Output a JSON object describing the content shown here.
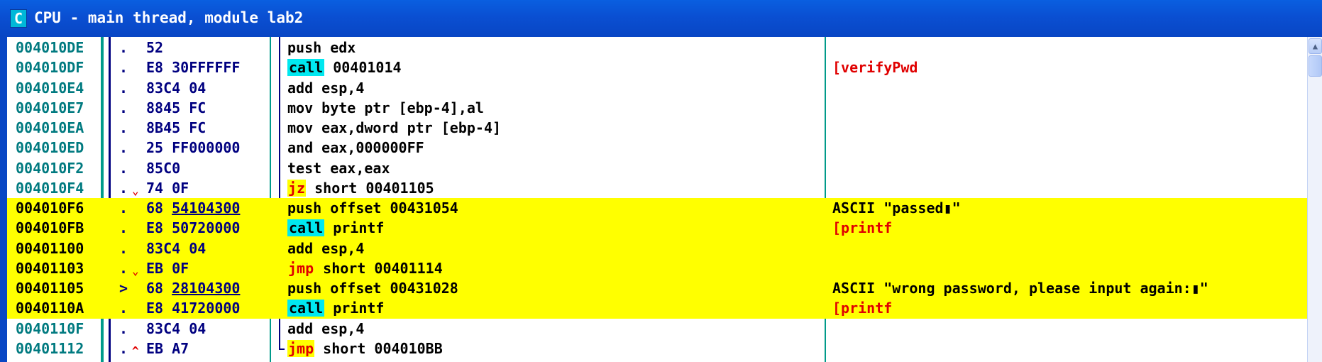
{
  "window": {
    "icon_letter": "C",
    "title": "CPU - main thread, module lab2"
  },
  "rows": [
    {
      "addr": "004010DE",
      "mark": ".",
      "jdir": "",
      "hex_pre": "52",
      "hex_ul": "",
      "mnem": "",
      "op": "push edx",
      "mnem_kind": "",
      "comment": "",
      "comment_kind": "",
      "hl": false
    },
    {
      "addr": "004010DF",
      "mark": ".",
      "jdir": "",
      "hex_pre": "E8 30FFFFFF",
      "hex_ul": "",
      "mnem": "call",
      "op": " 00401014",
      "mnem_kind": "call",
      "comment": "verifyPwd",
      "comment_kind": "fn",
      "hl": false
    },
    {
      "addr": "004010E4",
      "mark": ".",
      "jdir": "",
      "hex_pre": "83C4 04",
      "hex_ul": "",
      "mnem": "",
      "op": "add esp,4",
      "mnem_kind": "",
      "comment": "",
      "comment_kind": "",
      "hl": false
    },
    {
      "addr": "004010E7",
      "mark": ".",
      "jdir": "",
      "hex_pre": "8845 FC",
      "hex_ul": "",
      "mnem": "",
      "op": "mov byte ptr [ebp-4],al",
      "mnem_kind": "",
      "comment": "",
      "comment_kind": "",
      "hl": false
    },
    {
      "addr": "004010EA",
      "mark": ".",
      "jdir": "",
      "hex_pre": "8B45 FC",
      "hex_ul": "",
      "mnem": "",
      "op": "mov eax,dword ptr [ebp-4]",
      "mnem_kind": "",
      "comment": "",
      "comment_kind": "",
      "hl": false
    },
    {
      "addr": "004010ED",
      "mark": ".",
      "jdir": "",
      "hex_pre": "25 FF000000",
      "hex_ul": "",
      "mnem": "",
      "op": "and eax,000000FF",
      "mnem_kind": "",
      "comment": "",
      "comment_kind": "",
      "hl": false
    },
    {
      "addr": "004010F2",
      "mark": ".",
      "jdir": "",
      "hex_pre": "85C0",
      "hex_ul": "",
      "mnem": "",
      "op": "test eax,eax",
      "mnem_kind": "",
      "comment": "",
      "comment_kind": "",
      "hl": false
    },
    {
      "addr": "004010F4",
      "mark": ".",
      "jdir": "⌄",
      "hex_pre": "74 0F",
      "hex_ul": "",
      "mnem": "jz",
      "op": " short 00401105",
      "mnem_kind": "jmp",
      "comment": "",
      "comment_kind": "",
      "hl": false
    },
    {
      "addr": "004010F6",
      "mark": ".",
      "jdir": "",
      "hex_pre": "68 ",
      "hex_ul": "54104300",
      "mnem": "",
      "op": "push offset 00431054",
      "mnem_kind": "",
      "comment": "ASCII \"passed▮\"",
      "comment_kind": "",
      "hl": true
    },
    {
      "addr": "004010FB",
      "mark": ".",
      "jdir": "",
      "hex_pre": "E8 50720000",
      "hex_ul": "",
      "mnem": "call",
      "op": " printf",
      "mnem_kind": "call",
      "comment": "printf",
      "comment_kind": "fn",
      "hl": true
    },
    {
      "addr": "00401100",
      "mark": ".",
      "jdir": "",
      "hex_pre": "83C4 04",
      "hex_ul": "",
      "mnem": "",
      "op": "add esp,4",
      "mnem_kind": "",
      "comment": "",
      "comment_kind": "",
      "hl": true
    },
    {
      "addr": "00401103",
      "mark": ".",
      "jdir": "⌄",
      "hex_pre": "EB 0F",
      "hex_ul": "",
      "mnem": "jmp",
      "op": " short 00401114",
      "mnem_kind": "jmp",
      "comment": "",
      "comment_kind": "",
      "hl": true
    },
    {
      "addr": "00401105",
      "mark": ">",
      "jdir": "",
      "hex_pre": "68 ",
      "hex_ul": "28104300",
      "mnem": "",
      "op": "push offset 00431028",
      "mnem_kind": "",
      "comment": "ASCII \"wrong password, please input again:▮\"",
      "comment_kind": "",
      "hl": true
    },
    {
      "addr": "0040110A",
      "mark": ".",
      "jdir": "",
      "hex_pre": "E8 41720000",
      "hex_ul": "",
      "mnem": "call",
      "op": " printf",
      "mnem_kind": "call",
      "comment": "printf",
      "comment_kind": "fn",
      "hl": true
    },
    {
      "addr": "0040110F",
      "mark": ".",
      "jdir": "",
      "hex_pre": "83C4 04",
      "hex_ul": "",
      "mnem": "",
      "op": "add esp,4",
      "mnem_kind": "",
      "comment": "",
      "comment_kind": "",
      "hl": false
    },
    {
      "addr": "00401112",
      "mark": ".",
      "jdir": "^",
      "hex_pre": "EB A7",
      "hex_ul": "",
      "mnem": "jmp",
      "op": " short 004010BB",
      "mnem_kind": "jmp",
      "comment": "",
      "comment_kind": "",
      "hl": false
    }
  ],
  "colors": {
    "highlight": "#ffff00",
    "call_bg": "#00e8f0",
    "jump_text": "#e00000",
    "address": "#007a80",
    "hex": "#000080",
    "separator": "#009a8a",
    "title_bar": "#0a4fd2"
  }
}
